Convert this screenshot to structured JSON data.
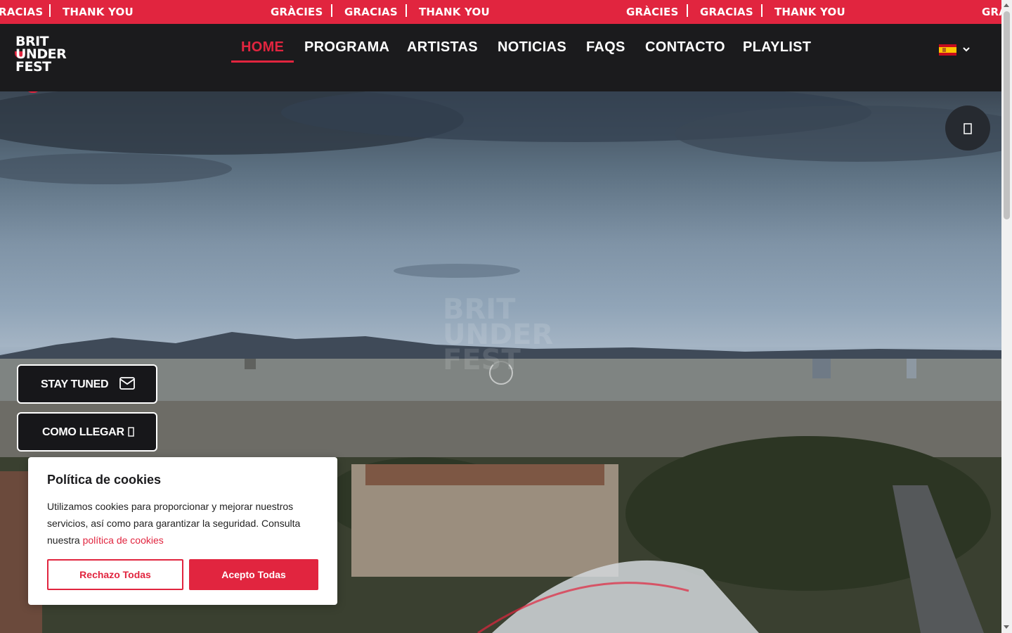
{
  "ticker": {
    "items": [
      "RACIAS",
      "THANK YOU",
      "GRÀCIES",
      "GRACIAS",
      "THANK YOU",
      "GRÀCIES",
      "GRACIAS",
      "THANK YOU",
      "GRÀ"
    ]
  },
  "header": {
    "logo_lines": [
      "BRIT",
      "UNDER",
      "FEST"
    ],
    "nav": [
      "HOME",
      "PROGRAMA",
      "ARTISTAS",
      "NOTICIAS",
      "FAQS",
      "CONTACTO",
      "PLAYLIST"
    ],
    "active_nav": "HOME",
    "language": "es-flag-icon"
  },
  "hero": {
    "music_button_icon": "music-icon",
    "buttons": {
      "stay_tuned": "STAY TUNED",
      "como_llegar": "COMO LLEGAR"
    }
  },
  "cookie": {
    "title": "Política de cookies",
    "text": "Utilizamos cookies para proporcionar y mejorar nuestros servicios, así como para garantizar la seguridad. Consulta nuestra",
    "link": "política de cookies",
    "reject": "Rechazo Todas",
    "accept": "Acepto Todas"
  },
  "colors": {
    "brand_red": "#e1253f",
    "header_bg": "#1b1b1d"
  }
}
